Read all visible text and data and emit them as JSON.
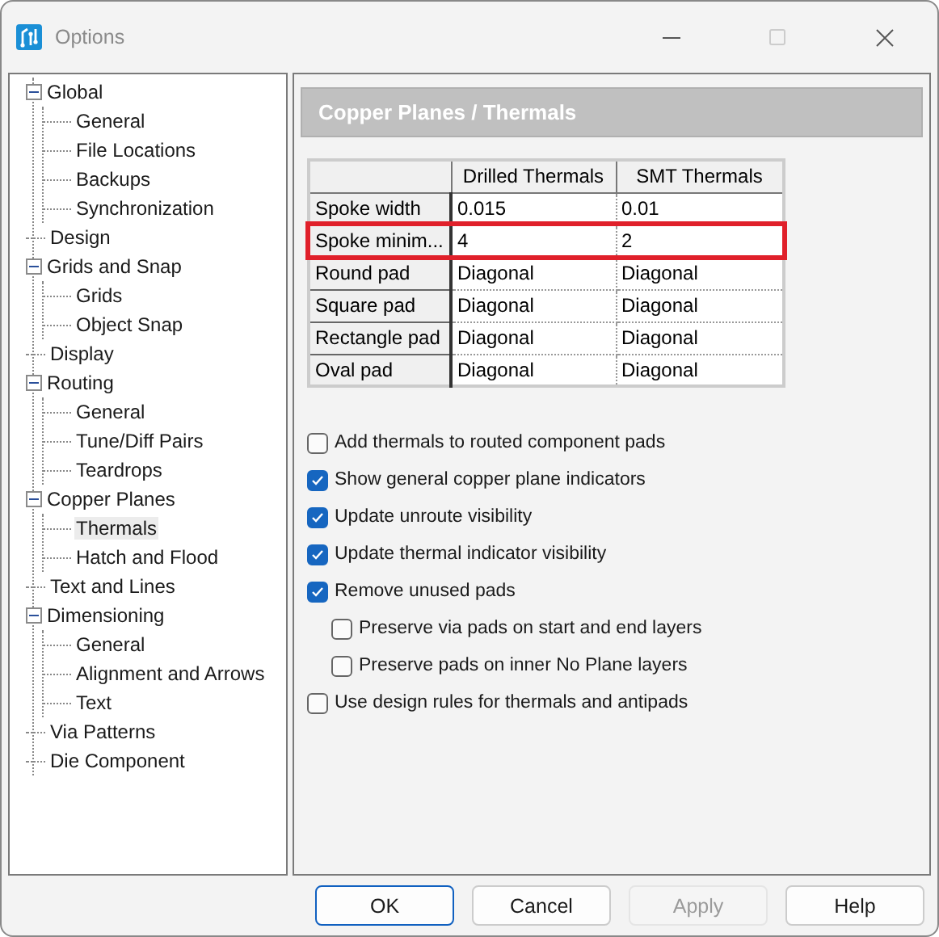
{
  "window": {
    "title": "Options"
  },
  "tree": [
    {
      "label": "Global",
      "expanded": true,
      "selected": false,
      "children": [
        {
          "label": "General",
          "selected": false
        },
        {
          "label": "File Locations",
          "selected": false
        },
        {
          "label": "Backups",
          "selected": false
        },
        {
          "label": "Synchronization",
          "selected": false
        }
      ]
    },
    {
      "label": "Design",
      "selected": false
    },
    {
      "label": "Grids and Snap",
      "expanded": true,
      "selected": false,
      "children": [
        {
          "label": "Grids",
          "selected": false
        },
        {
          "label": "Object Snap",
          "selected": false
        }
      ]
    },
    {
      "label": "Display",
      "selected": false
    },
    {
      "label": "Routing",
      "expanded": true,
      "selected": false,
      "children": [
        {
          "label": "General",
          "selected": false
        },
        {
          "label": "Tune/Diff Pairs",
          "selected": false
        },
        {
          "label": "Teardrops",
          "selected": false
        }
      ]
    },
    {
      "label": "Copper Planes",
      "expanded": true,
      "selected": false,
      "children": [
        {
          "label": "Thermals",
          "selected": true
        },
        {
          "label": "Hatch and Flood",
          "selected": false
        }
      ]
    },
    {
      "label": "Text and Lines",
      "selected": false
    },
    {
      "label": "Dimensioning",
      "expanded": true,
      "selected": false,
      "children": [
        {
          "label": "General",
          "selected": false
        },
        {
          "label": "Alignment and Arrows",
          "selected": false
        },
        {
          "label": "Text",
          "selected": false
        }
      ]
    },
    {
      "label": "Via Patterns",
      "selected": false
    },
    {
      "label": "Die Component",
      "selected": false
    }
  ],
  "page_title": "Copper Planes / Thermals",
  "table": {
    "columns": [
      "Drilled Thermals",
      "SMT Thermals"
    ],
    "rows": [
      {
        "label": "Spoke width",
        "cells": [
          "0.015",
          "0.01"
        ],
        "highlighted": false
      },
      {
        "label": "Spoke minim...",
        "cells": [
          "4",
          "2"
        ],
        "highlighted": true
      },
      {
        "label": "Round pad",
        "cells": [
          "Diagonal",
          "Diagonal"
        ],
        "highlighted": false
      },
      {
        "label": "Square pad",
        "cells": [
          "Diagonal",
          "Diagonal"
        ],
        "highlighted": false
      },
      {
        "label": "Rectangle pad",
        "cells": [
          "Diagonal",
          "Diagonal"
        ],
        "highlighted": false
      },
      {
        "label": "Oval pad",
        "cells": [
          "Diagonal",
          "Diagonal"
        ],
        "highlighted": false
      }
    ]
  },
  "options": [
    {
      "label": "Add thermals to routed component pads",
      "checked": false
    },
    {
      "label": "Show general copper plane indicators",
      "checked": true
    },
    {
      "label": "Update unroute visibility",
      "checked": true
    },
    {
      "label": "Update thermal indicator visibility",
      "checked": true
    },
    {
      "label": "Remove unused pads",
      "checked": true,
      "children": [
        {
          "label": "Preserve via pads on start and end layers",
          "checked": false
        },
        {
          "label": "Preserve pads on inner No Plane layers",
          "checked": false
        }
      ]
    },
    {
      "label": "Use design rules for thermals and antipads",
      "checked": false
    }
  ],
  "buttons": [
    {
      "label": "OK",
      "default": true,
      "disabled": false
    },
    {
      "label": "Cancel",
      "default": false,
      "disabled": false
    },
    {
      "label": "Apply",
      "default": false,
      "disabled": true
    },
    {
      "label": "Help",
      "default": false,
      "disabled": false
    }
  ]
}
